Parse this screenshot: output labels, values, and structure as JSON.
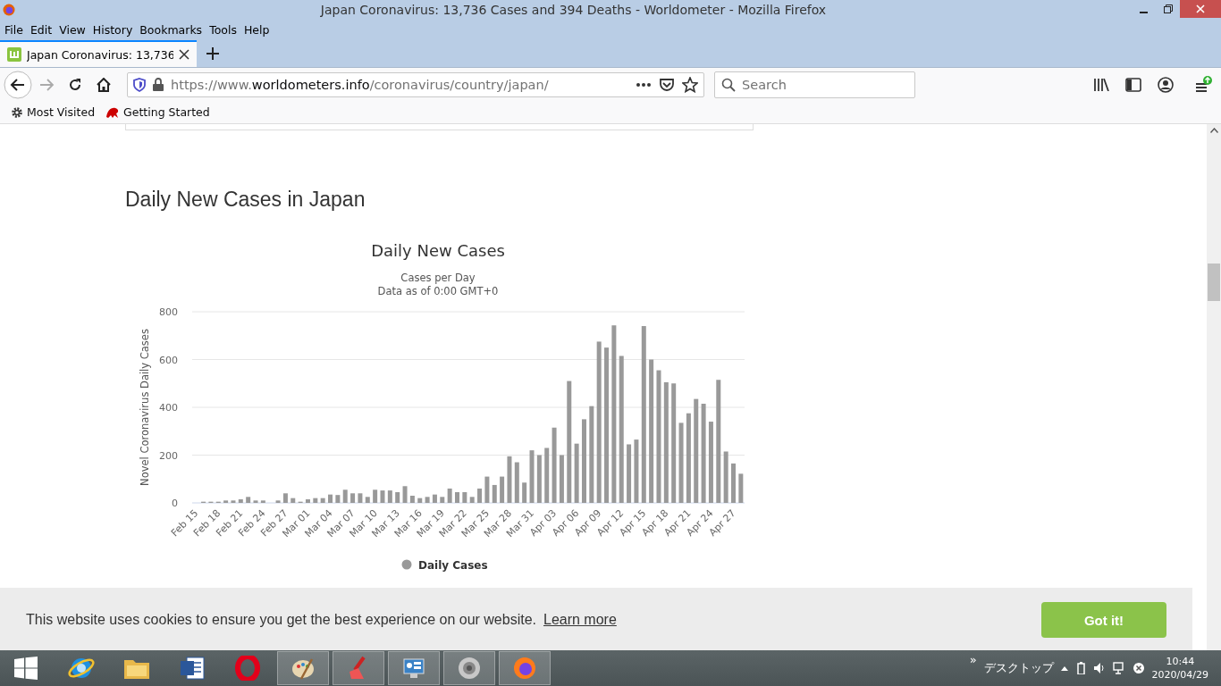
{
  "window": {
    "title": "Japan Coronavirus: 13,736 Cases and 394 Deaths - Worldometer - Mozilla Firefox"
  },
  "menu": [
    "File",
    "Edit",
    "View",
    "History",
    "Bookmarks",
    "Tools",
    "Help"
  ],
  "tabs": [
    {
      "label": "Japan Coronavirus: 13,736",
      "selected": true
    }
  ],
  "address": {
    "prefix": "https://www.",
    "domain": "worldometers.info",
    "path": "/coronavirus/country/japan/"
  },
  "search": {
    "placeholder": "Search"
  },
  "bookmarks": [
    "Most Visited",
    "Getting Started"
  ],
  "page": {
    "heading": "Daily New Cases in Japan",
    "chart_subtitle": [
      "Cases per Day",
      "Data as of 0:00 GMT+0"
    ],
    "chart_data": {
      "type": "bar",
      "title": "Daily New Cases",
      "ylabel": "Novel Coronavirus Daily Cases",
      "ylim": [
        0,
        800
      ],
      "yticks": [
        0,
        200,
        400,
        600,
        800
      ],
      "grid": true,
      "categories": [
        "Feb 15",
        null,
        null,
        "Feb 18",
        null,
        null,
        "Feb 21",
        null,
        null,
        "Feb 24",
        null,
        null,
        "Feb 27",
        null,
        null,
        "Mar 01",
        null,
        null,
        "Mar 04",
        null,
        null,
        "Mar 07",
        null,
        null,
        "Mar 10",
        null,
        null,
        "Mar 13",
        null,
        null,
        "Mar 16",
        null,
        null,
        "Mar 19",
        null,
        null,
        "Mar 22",
        null,
        null,
        "Mar 25",
        null,
        null,
        "Mar 28",
        null,
        null,
        "Mar 31",
        null,
        null,
        "Apr 03",
        null,
        null,
        "Apr 06",
        null,
        null,
        "Apr 09",
        null,
        null,
        "Apr 12",
        null,
        null,
        "Apr 15",
        null,
        null,
        "Apr 18",
        null,
        null,
        "Apr 21",
        null,
        null,
        "Apr 24",
        null,
        null,
        "Apr 27",
        null
      ],
      "series": [
        {
          "name": "Daily Cases",
          "color": "#999999",
          "values": [
            0,
            5,
            5,
            5,
            10,
            10,
            15,
            25,
            10,
            10,
            0,
            10,
            40,
            20,
            5,
            15,
            20,
            20,
            35,
            33,
            55,
            40,
            40,
            25,
            55,
            52,
            52,
            45,
            70,
            30,
            20,
            25,
            35,
            25,
            60,
            45,
            45,
            25,
            60,
            110,
            75,
            110,
            195,
            170,
            85,
            220,
            200,
            230,
            315,
            200,
            510,
            248,
            350,
            405,
            675,
            650,
            743,
            615,
            245,
            265,
            740,
            600,
            555,
            505,
            500,
            335,
            375,
            435,
            415,
            340,
            515,
            215,
            165,
            122
          ]
        }
      ]
    }
  },
  "cookie_bar": {
    "text": "This website uses cookies to ensure you get the best experience on our website.",
    "link": "Learn more",
    "button": "Got it!"
  },
  "taskbar": {
    "overflow": "»",
    "desktop_label": "デスクトップ",
    "time": "10:44",
    "date": "2020/04/29"
  }
}
